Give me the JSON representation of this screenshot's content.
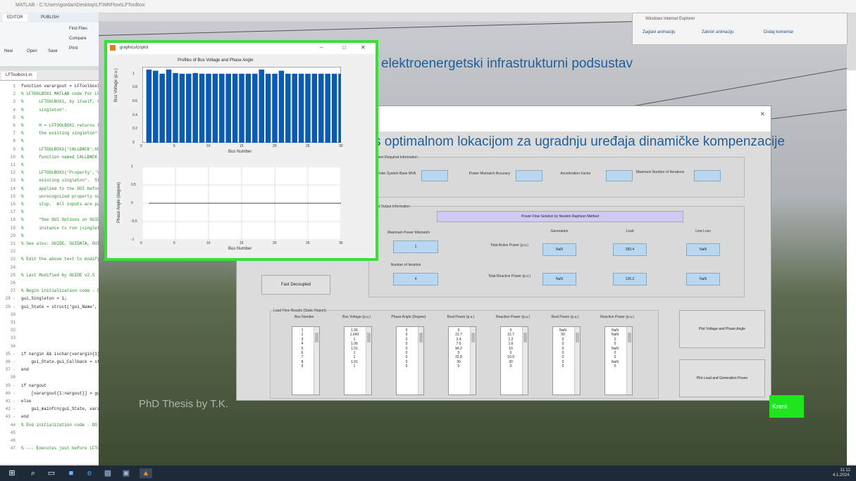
{
  "matlab": {
    "title": "MATLAB - C:\\Users\\gordan\\Desktop\\LF\\NRFlow\\LFToolbox",
    "tabs": [
      "EDITOR",
      "PUBLISH"
    ],
    "tool_labels": [
      "New",
      "Open",
      "Save",
      "Find Files",
      "Compare",
      "Print"
    ],
    "file_tab": "LFToolbox1.m",
    "code": [
      {
        "n": "1",
        "t": "function varargout = LFToolbox1(varargin)",
        "k": true
      },
      {
        "n": "2",
        "t": "% LFTOOLBOX1 MATLAB code for LFToolbox1.fig",
        "k": false
      },
      {
        "n": "3",
        "t": "%      LFTOOLBOX1, by itself, creates a new",
        "k": false
      },
      {
        "n": "4",
        "t": "%      singleton*.",
        "k": false
      },
      {
        "n": "5",
        "t": "%",
        "k": false
      },
      {
        "n": "6",
        "t": "%      H = LFTOOLBOX1 returns the handle",
        "k": false
      },
      {
        "n": "7",
        "t": "%      the existing singleton*.",
        "k": false
      },
      {
        "n": "8",
        "t": "%",
        "k": false
      },
      {
        "n": "9",
        "t": "%      LFTOOLBOX1('CALLBACK',hObject,...)",
        "k": false
      },
      {
        "n": "10",
        "t": "%      function named CALLBACK in LFTOOLBOX1",
        "k": false
      },
      {
        "n": "11",
        "t": "%",
        "k": false
      },
      {
        "n": "12",
        "t": "%      LFTOOLBOX1('Property','Value',...)",
        "k": false
      },
      {
        "n": "13",
        "t": "%      existing singleton*.  Starting from",
        "k": false
      },
      {
        "n": "14",
        "t": "%      applied to the GUI before",
        "k": false
      },
      {
        "n": "15",
        "t": "%      unrecognized property name",
        "k": false
      },
      {
        "n": "16",
        "t": "%      stop.  All inputs are passed",
        "k": false
      },
      {
        "n": "17",
        "t": "%",
        "k": false
      },
      {
        "n": "18",
        "t": "%      *See GUI Options on GUIDE's",
        "k": false
      },
      {
        "n": "19",
        "t": "%      instance to run (singleton)\".",
        "k": false
      },
      {
        "n": "20",
        "t": "%",
        "k": false
      },
      {
        "n": "21",
        "t": "% See also: GUIDE, GUIDATA, GUIHANDLES",
        "k": false
      },
      {
        "n": "22",
        "t": "",
        "k": false
      },
      {
        "n": "23",
        "t": "% Edit the above text to modify the",
        "k": false
      },
      {
        "n": "24",
        "t": "",
        "k": false
      },
      {
        "n": "25",
        "t": "% Last Modified by GUIDE v2.5",
        "k": false
      },
      {
        "n": "26",
        "t": "",
        "k": false
      },
      {
        "n": "27",
        "t": "% Begin initialization code - DO NOT",
        "k": false
      },
      {
        "n": "28 -",
        "t": "gui_Singleton = 1;",
        "k": true
      },
      {
        "n": "29 -",
        "t": "gui_State = struct('gui_Name',",
        "k": true
      },
      {
        "n": "30",
        "t": "",
        "k": false
      },
      {
        "n": "31",
        "t": "",
        "k": false
      },
      {
        "n": "32",
        "t": "",
        "k": false
      },
      {
        "n": "33",
        "t": "",
        "k": false
      },
      {
        "n": "34",
        "t": "",
        "k": false
      },
      {
        "n": "35 -",
        "t": "if nargin && ischar(varargin{1})",
        "k": true
      },
      {
        "n": "36 -",
        "t": "    gui_State.gui_Callback = str2func",
        "k": true
      },
      {
        "n": "37 -",
        "t": "end",
        "k": true
      },
      {
        "n": "38",
        "t": "",
        "k": false
      },
      {
        "n": "39 -",
        "t": "if nargout",
        "k": true
      },
      {
        "n": "40 -",
        "t": "    [varargout{1:nargout}] = gui_main",
        "k": true
      },
      {
        "n": "41 -",
        "t": "else",
        "k": true
      },
      {
        "n": "42 -",
        "t": "    gui_mainfcn(gui_State, varargin{:});",
        "k": true
      },
      {
        "n": "43 -",
        "t": "end",
        "k": true
      },
      {
        "n": "44",
        "t": "% End initialization code - DO NOT EDIT",
        "k": false
      },
      {
        "n": "45",
        "t": "",
        "k": false
      },
      {
        "n": "46",
        "t": "",
        "k": false
      },
      {
        "n": "47",
        "t": "% --- Executes just before LFToolbox1 is made visible.",
        "k": false
      }
    ]
  },
  "ie": {
    "title": "Windows Internet Explorer",
    "links": [
      "Zaglavi animaciju",
      "Zatvori animaciju",
      "Dodaj komentar"
    ]
  },
  "app": {
    "header": "elektroenergetski infrastrukturni podsustav",
    "title": "s optimalnom lokacijom za ugradnju uređaja dinamičke kompenzacije",
    "system_panel": {
      "title": "System Required Information",
      "fields": [
        "Enter System Base MVA",
        "Power Mismatch Accuracy",
        "Acceleration Factor",
        "Maximum Number of Iterations"
      ]
    },
    "output_panel": {
      "title": "Load Output Information",
      "method": "Power Flow Solution by Newton Raphson Method",
      "max_mismatch_label": "Maximum Power Mismatch",
      "max_mismatch_value": "1",
      "iterations_label": "Number of Iteration",
      "iterations_value": "4",
      "col_generation": "Generation",
      "col_load": "Load",
      "col_losses": "Line Loss",
      "active_label": "Total Active Power (p.u.)",
      "reactive_label": "Total Reactive Power (p.u.)",
      "active_values": [
        "NaN",
        "283.4",
        "NaN"
      ],
      "reactive_values": [
        "NaN",
        "126.2",
        "NaN"
      ]
    },
    "fast_decoupled": "Fast Decoupled",
    "results_panel": {
      "title": "Load Flow Results (Static Report)",
      "columns": [
        {
          "head": "Bus Number",
          "values": [
            "1",
            "2",
            "3",
            "4",
            "5",
            "6",
            "7",
            "8",
            "9"
          ]
        },
        {
          "head": "Bus Voltage (p.u.)",
          "values": [
            "1.06",
            "1.043",
            "1",
            "1.06",
            "1.01",
            "1",
            "1",
            "1.01",
            "1"
          ]
        },
        {
          "head": "Phase Angle (Degree)",
          "values": [
            "0",
            "0",
            "0",
            "0",
            "0",
            "0",
            "0",
            "0",
            "0"
          ]
        },
        {
          "head": "Real Power (p.u.)",
          "values": [
            "0",
            "21.7",
            "2.4",
            "7.6",
            "94.2",
            "0",
            "22.8",
            "30",
            "0"
          ]
        },
        {
          "head": "Reactive Power (p.u.)",
          "values": [
            "0",
            "12.7",
            "1.2",
            "1.6",
            "19",
            "0",
            "10.9",
            "30",
            "0"
          ]
        },
        {
          "head": "Real Power (p.u.)",
          "values": [
            "NaN",
            "50",
            "0",
            "0",
            "0",
            "0",
            "0",
            "0",
            "0"
          ]
        },
        {
          "head": "Reactive Power (p.u.)",
          "values": [
            "NaN",
            "NaN",
            "0",
            "0",
            "NaN",
            "0",
            "0",
            "NaN",
            "0"
          ]
        }
      ]
    },
    "plot_voltage_button": "Plot Voltage and Phase Angle",
    "plot_power_button": "Plot Load and Generation Power",
    "kreni": "Kreni",
    "watermark": "PhD Thesis by T.K."
  },
  "figure": {
    "window_title": "graphicsfcnplot",
    "plot1_title": "Profiles of Bus Voltage and Phase Angle",
    "plot1_ylabel": "Bus Voltage (p.u.)",
    "plot1_xlabel": "Bus Number",
    "plot2_ylabel": "Phase Angle (degree)",
    "plot2_xlabel": "Bus Number",
    "x_ticks": [
      "0",
      "5",
      "10",
      "15",
      "20",
      "25",
      "30"
    ],
    "y1_ticks": [
      "1",
      "0.8",
      "0.6",
      "0.4",
      "0.2",
      "0"
    ],
    "y2_ticks": [
      "1",
      "0.5",
      "0",
      "-0.5",
      "-1"
    ]
  },
  "chart_data": {
    "type": "bar",
    "x": [
      1,
      2,
      3,
      4,
      5,
      6,
      7,
      8,
      9,
      10,
      11,
      12,
      13,
      14,
      15,
      16,
      17,
      18,
      19,
      20,
      21,
      22,
      23,
      24,
      25,
      26,
      27,
      28,
      29,
      30
    ],
    "values": [
      1.06,
      1.043,
      1.0,
      1.06,
      1.01,
      1.0,
      1.0,
      1.01,
      1.0,
      1.0,
      1.0,
      1.0,
      1.0,
      1.0,
      1.0,
      1.0,
      1.0,
      1.06,
      1.0,
      1.0,
      1.043,
      1.0,
      1.0,
      1.0,
      1.0,
      1.0,
      1.0,
      1.0,
      1.0,
      1.0
    ],
    "xlim": [
      0,
      30
    ],
    "ylim": [
      0,
      1.1
    ],
    "bar_color": "#0b5bb0",
    "phase_values": [
      0,
      0,
      0,
      0,
      0,
      0,
      0,
      0,
      0,
      0,
      0,
      0,
      0,
      0,
      0,
      0,
      0,
      0,
      0,
      0,
      0,
      0,
      0,
      0,
      0,
      0,
      0,
      0,
      0,
      0
    ],
    "phase_ylim": [
      -1,
      1
    ],
    "grid": true
  },
  "taskbar": {
    "time": "11:12",
    "date": "4.1.2024."
  }
}
